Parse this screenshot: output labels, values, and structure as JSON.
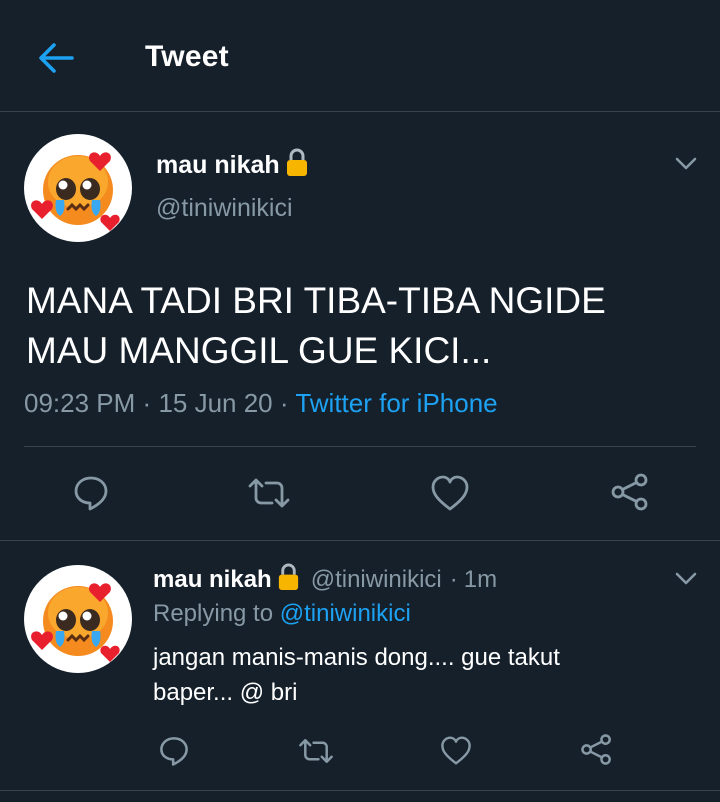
{
  "header": {
    "title": "Tweet",
    "back_icon": "arrow-left-icon"
  },
  "colors": {
    "accent": "#1da1f2",
    "background": "#15202b",
    "muted": "#8899a6",
    "divider": "#38444d"
  },
  "main_tweet": {
    "display_name": "mau nikah",
    "handle": "@tiniwinikici",
    "text_line1": "MANA TADI BRI TIBA-TIBA NGIDE",
    "text_line2": "MAU MANGGIL GUE KICI...",
    "time": "09:23 PM",
    "date": "15 Jun 20",
    "source": "Twitter for iPhone",
    "sep": "·"
  },
  "reply": {
    "display_name": "mau nikah",
    "handle": "@tiniwinikici",
    "time_ago": "1m",
    "sep": "·",
    "replying_label": "Replying to",
    "replying_to": "@tiniwinikici",
    "text_line1": "jangan manis-manis dong.... gue takut",
    "text_line2": "baper... @ bri"
  }
}
